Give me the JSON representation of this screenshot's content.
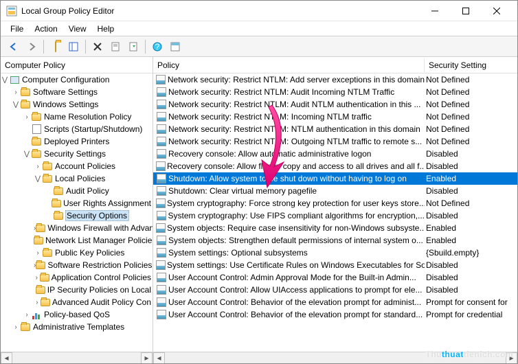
{
  "window": {
    "title": "Local Group Policy Editor"
  },
  "menu": [
    "File",
    "Action",
    "View",
    "Help"
  ],
  "tree": {
    "header": "Computer Policy",
    "nodes": [
      {
        "label": "Computer Configuration",
        "indent": 0,
        "exp": "open",
        "icon": "pc"
      },
      {
        "label": "Software Settings",
        "indent": 1,
        "exp": "closed",
        "icon": "folder"
      },
      {
        "label": "Windows Settings",
        "indent": 1,
        "exp": "open",
        "icon": "folder"
      },
      {
        "label": "Name Resolution Policy",
        "indent": 2,
        "exp": "closed",
        "icon": "folder"
      },
      {
        "label": "Scripts (Startup/Shutdown)",
        "indent": 2,
        "exp": "none",
        "icon": "scroll"
      },
      {
        "label": "Deployed Printers",
        "indent": 2,
        "exp": "none",
        "icon": "folder"
      },
      {
        "label": "Security Settings",
        "indent": 2,
        "exp": "open",
        "icon": "folder"
      },
      {
        "label": "Account Policies",
        "indent": 3,
        "exp": "closed",
        "icon": "folder"
      },
      {
        "label": "Local Policies",
        "indent": 3,
        "exp": "open",
        "icon": "folder"
      },
      {
        "label": "Audit Policy",
        "indent": 4,
        "exp": "none",
        "icon": "folder"
      },
      {
        "label": "User Rights Assignment",
        "indent": 4,
        "exp": "none",
        "icon": "folder"
      },
      {
        "label": "Security Options",
        "indent": 4,
        "exp": "none",
        "icon": "folder",
        "sel": true
      },
      {
        "label": "Windows Firewall with Advanc",
        "indent": 3,
        "exp": "closed",
        "icon": "folder"
      },
      {
        "label": "Network List Manager Policie",
        "indent": 3,
        "exp": "none",
        "icon": "folder"
      },
      {
        "label": "Public Key Policies",
        "indent": 3,
        "exp": "closed",
        "icon": "folder"
      },
      {
        "label": "Software Restriction Policies",
        "indent": 3,
        "exp": "closed",
        "icon": "folder"
      },
      {
        "label": "Application Control Policies",
        "indent": 3,
        "exp": "closed",
        "icon": "folder"
      },
      {
        "label": "IP Security Policies on Local",
        "indent": 3,
        "exp": "none",
        "icon": "folder"
      },
      {
        "label": "Advanced Audit Policy Con",
        "indent": 3,
        "exp": "closed",
        "icon": "folder"
      },
      {
        "label": "Policy-based QoS",
        "indent": 2,
        "exp": "closed",
        "icon": "bars"
      },
      {
        "label": "Administrative Templates",
        "indent": 1,
        "exp": "closed",
        "icon": "folder"
      }
    ]
  },
  "list": {
    "header_policy": "Policy",
    "header_setting": "Security Setting",
    "rows": [
      {
        "policy": "Network security: Restrict NTLM: Add server exceptions in this domain",
        "setting": "Not Defined"
      },
      {
        "policy": "Network security: Restrict NTLM: Audit Incoming NTLM Traffic",
        "setting": "Not Defined"
      },
      {
        "policy": "Network security: Restrict NTLM: Audit NTLM authentication in this ...",
        "setting": "Not Defined"
      },
      {
        "policy": "Network security: Restrict NTLM: Incoming NTLM traffic",
        "setting": "Not Defined"
      },
      {
        "policy": "Network security: Restrict NTLM: NTLM authentication in this domain",
        "setting": "Not Defined"
      },
      {
        "policy": "Network security: Restrict NTLM: Outgoing NTLM traffic to remote s...",
        "setting": "Not Defined"
      },
      {
        "policy": "Recovery console: Allow automatic administrative logon",
        "setting": "Disabled"
      },
      {
        "policy": "Recovery console: Allow floppy copy and access to all drives and all f...",
        "setting": "Disabled"
      },
      {
        "policy": "Shutdown: Allow system to be shut down without having to log on",
        "setting": "Enabled",
        "sel": true
      },
      {
        "policy": "Shutdown: Clear virtual memory pagefile",
        "setting": "Disabled"
      },
      {
        "policy": "System cryptography: Force strong key protection for user keys store...",
        "setting": "Not Defined"
      },
      {
        "policy": "System cryptography: Use FIPS compliant algorithms for encryption,...",
        "setting": "Disabled"
      },
      {
        "policy": "System objects: Require case insensitivity for non-Windows subsyste...",
        "setting": "Enabled"
      },
      {
        "policy": "System objects: Strengthen default permissions of internal system o...",
        "setting": "Enabled"
      },
      {
        "policy": "System settings: Optional subsystems",
        "setting": "{Sbuild.empty}"
      },
      {
        "policy": "System settings: Use Certificate Rules on Windows Executables for So...",
        "setting": "Disabled"
      },
      {
        "policy": "User Account Control: Admin Approval Mode for the Built-in Admin...",
        "setting": "Disabled"
      },
      {
        "policy": "User Account Control: Allow UIAccess applications to prompt for ele...",
        "setting": "Disabled"
      },
      {
        "policy": "User Account Control: Behavior of the elevation prompt for administ...",
        "setting": "Prompt for consent for"
      },
      {
        "policy": "User Account Control: Behavior of the elevation prompt for standard...",
        "setting": "Prompt for credential"
      }
    ]
  },
  "watermark_a": "Thu",
  "watermark_b": "thuat",
  "watermark_c": "tienich.com"
}
